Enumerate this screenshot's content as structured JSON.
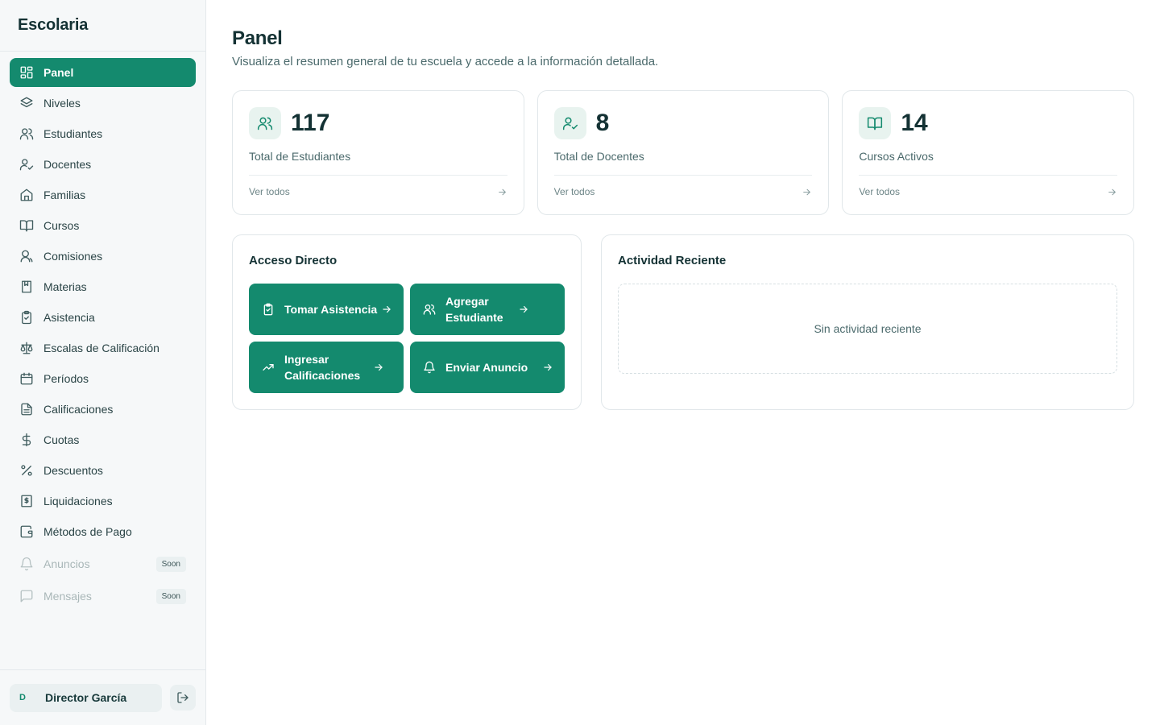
{
  "app": {
    "name": "Escolaria"
  },
  "sidebar": {
    "items": [
      {
        "label": "Panel",
        "icon": "dashboard-icon"
      },
      {
        "label": "Niveles",
        "icon": "layers-icon"
      },
      {
        "label": "Estudiantes",
        "icon": "users-icon"
      },
      {
        "label": "Docentes",
        "icon": "user-check-icon"
      },
      {
        "label": "Familias",
        "icon": "home-icon"
      },
      {
        "label": "Cursos",
        "icon": "book-open-icon"
      },
      {
        "label": "Comisiones",
        "icon": "group-icon"
      },
      {
        "label": "Materias",
        "icon": "bookmark-book-icon"
      },
      {
        "label": "Asistencia",
        "icon": "clipboard-check-icon"
      },
      {
        "label": "Escalas de Calificación",
        "icon": "scale-icon"
      },
      {
        "label": "Períodos",
        "icon": "calendar-icon"
      },
      {
        "label": "Calificaciones",
        "icon": "file-text-icon"
      },
      {
        "label": "Cuotas",
        "icon": "dollar-icon"
      },
      {
        "label": "Descuentos",
        "icon": "percent-icon"
      },
      {
        "label": "Liquidaciones",
        "icon": "receipt-icon"
      },
      {
        "label": "Métodos de Pago",
        "icon": "wallet-icon"
      }
    ],
    "disabled_items": [
      {
        "label": "Anuncios",
        "badge": "Soon",
        "icon": "bell-icon"
      },
      {
        "label": "Mensajes",
        "badge": "Soon",
        "icon": "message-icon"
      }
    ],
    "user": {
      "initial": "D",
      "name": "Director García"
    }
  },
  "header": {
    "title": "Panel",
    "subtitle": "Visualiza el resumen general de tu escuela y accede a la información detallada."
  },
  "stats": [
    {
      "value": "117",
      "label": "Total de Estudiantes",
      "link": "Ver todos",
      "icon": "users-icon"
    },
    {
      "value": "8",
      "label": "Total de Docentes",
      "link": "Ver todos",
      "icon": "user-check-icon"
    },
    {
      "value": "14",
      "label": "Cursos Activos",
      "link": "Ver todos",
      "icon": "book-open-icon"
    }
  ],
  "quick_access": {
    "title": "Acceso Directo",
    "buttons": [
      {
        "label": "Tomar Asistencia",
        "icon": "clipboard-check-icon"
      },
      {
        "label": "Agregar Estudiante",
        "icon": "users-icon"
      },
      {
        "label": "Ingresar Calificaciones",
        "icon": "trending-up-icon"
      },
      {
        "label": "Enviar Anuncio",
        "icon": "bell-icon"
      }
    ]
  },
  "activity": {
    "title": "Actividad Reciente",
    "empty_text": "Sin actividad reciente"
  },
  "colors": {
    "accent": "#148a6e",
    "sidebar_bg": "#f6f8f9",
    "text_dark": "#143234"
  }
}
